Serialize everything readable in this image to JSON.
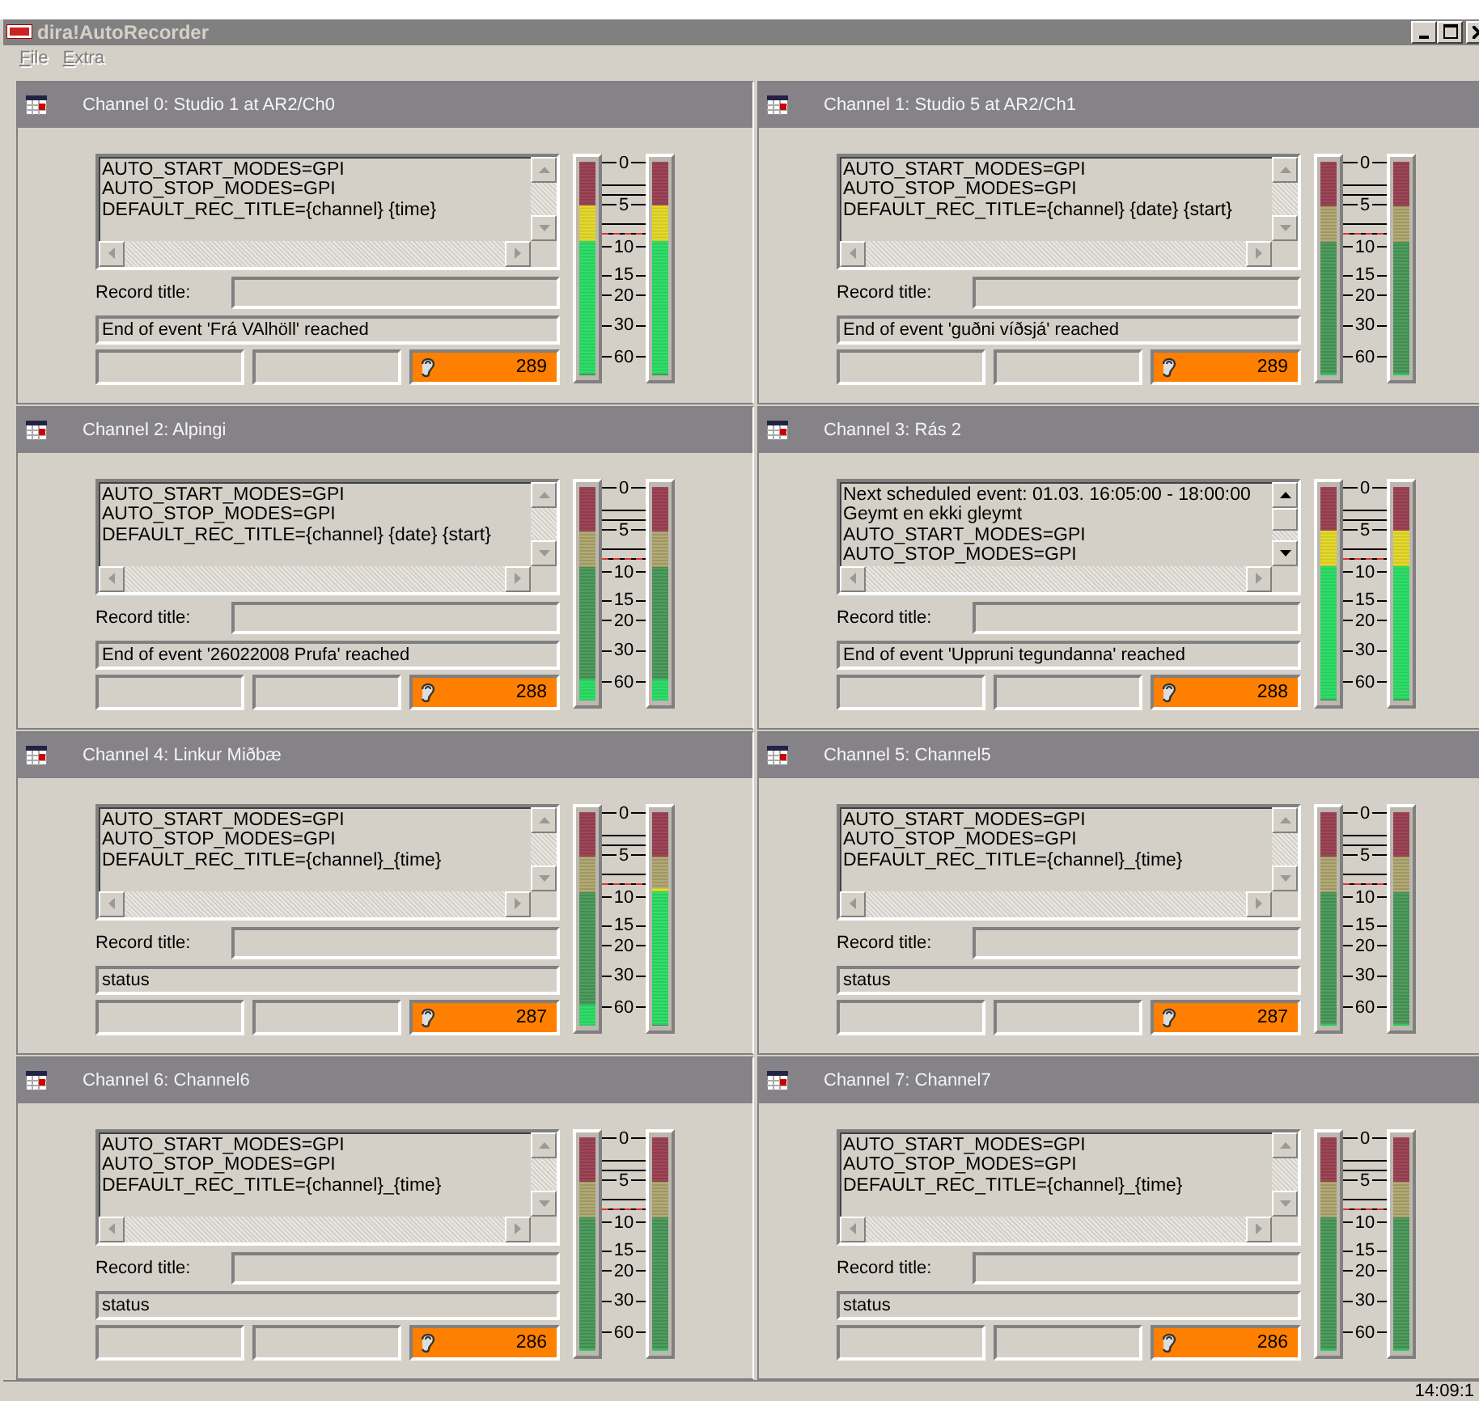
{
  "window": {
    "title": "dira!AutoRecorder"
  },
  "menu": [
    {
      "label": "File",
      "disabled": true
    },
    {
      "label": "Extra",
      "disabled": true
    }
  ],
  "channels": [
    {
      "title": "Channel 0: Studio 1 at AR2/Ch0",
      "lines": [
        "AUTO_START_MODES=GPI",
        "AUTO_STOP_MODES=GPI",
        "DEFAULT_REC_TITLE={channel} {time}"
      ],
      "scrollable": false,
      "record_title_label": "Record title:",
      "status": "End of event 'Frá VAlhöll' reached",
      "counter": "289",
      "meters": [
        {
          "level": 0.79
        },
        {
          "level": 0.79
        }
      ],
      "scale": [
        "0",
        "5",
        "10",
        "15",
        "20",
        "30",
        "60"
      ]
    },
    {
      "title": "Channel 1: Studio 5 at AR2/Ch1",
      "lines": [
        "AUTO_START_MODES=GPI",
        "AUTO_STOP_MODES=GPI",
        "DEFAULT_REC_TITLE={channel} {date} {start}"
      ],
      "scrollable": false,
      "record_title_label": "Record title:",
      "status": "End of event 'guðni víðsjá' reached",
      "counter": "289",
      "meters": [
        {
          "level": 0
        },
        {
          "level": 0
        }
      ],
      "scale": [
        "0",
        "5",
        "10",
        "15",
        "20",
        "30",
        "60"
      ]
    },
    {
      "title": "Channel 2: Alpingi",
      "lines": [
        "AUTO_START_MODES=GPI",
        "AUTO_STOP_MODES=GPI",
        "DEFAULT_REC_TITLE={channel} {date} {start}"
      ],
      "scrollable": false,
      "record_title_label": "Record title:",
      "status": "End of event '26022008 Prufa' reached",
      "counter": "288",
      "meters": [
        {
          "level": 0.1
        },
        {
          "level": 0.1
        }
      ],
      "scale": [
        "0",
        "5",
        "10",
        "15",
        "20",
        "30",
        "60"
      ]
    },
    {
      "title": "Channel 3: Rás 2",
      "lines": [
        "Next scheduled event: 01.03. 16:05:00 - 18:00:00",
        "Geymt en ekki gleymt",
        "AUTO_START_MODES=GPI",
        "AUTO_STOP_MODES=GPI"
      ],
      "scrollable": true,
      "record_title_label": "Record title:",
      "status": "End of event 'Uppruni tegundanna' reached",
      "counter": "288",
      "meters": [
        {
          "level": 0.79
        },
        {
          "level": 0.79
        }
      ],
      "scale": [
        "0",
        "5",
        "10",
        "15",
        "20",
        "30",
        "60"
      ]
    },
    {
      "title": "Channel 4: Linkur Miðbæ",
      "lines": [
        "AUTO_START_MODES=GPI",
        "AUTO_STOP_MODES=GPI",
        "DEFAULT_REC_TITLE={channel}_{time}"
      ],
      "scrollable": false,
      "record_title_label": "Record title:",
      "status": "status",
      "counter": "287",
      "meters": [
        {
          "level": 0.1
        },
        {
          "level": 0.64
        }
      ],
      "scale": [
        "0",
        "5",
        "10",
        "15",
        "20",
        "30",
        "60"
      ]
    },
    {
      "title": "Channel 5: Channel5",
      "lines": [
        "AUTO_START_MODES=GPI",
        "AUTO_STOP_MODES=GPI",
        "DEFAULT_REC_TITLE={channel}_{time}"
      ],
      "scrollable": false,
      "record_title_label": "Record title:",
      "status": "status",
      "counter": "287",
      "meters": [
        {
          "level": 0
        },
        {
          "level": 0
        }
      ],
      "scale": [
        "0",
        "5",
        "10",
        "15",
        "20",
        "30",
        "60"
      ]
    },
    {
      "title": "Channel 6: Channel6",
      "lines": [
        "AUTO_START_MODES=GPI",
        "AUTO_STOP_MODES=GPI",
        "DEFAULT_REC_TITLE={channel}_{time}"
      ],
      "scrollable": false,
      "record_title_label": "Record title:",
      "status": "status",
      "counter": "286",
      "meters": [
        {
          "level": 0
        },
        {
          "level": 0
        }
      ],
      "scale": [
        "0",
        "5",
        "10",
        "15",
        "20",
        "30",
        "60"
      ]
    },
    {
      "title": "Channel 7: Channel7",
      "lines": [
        "AUTO_START_MODES=GPI",
        "AUTO_STOP_MODES=GPI",
        "DEFAULT_REC_TITLE={channel}_{time}"
      ],
      "scrollable": false,
      "record_title_label": "Record title:",
      "status": "status",
      "counter": "286",
      "meters": [
        {
          "level": 0
        },
        {
          "level": 0
        }
      ],
      "scale": [
        "0",
        "5",
        "10",
        "15",
        "20",
        "30",
        "60"
      ]
    }
  ],
  "status_bar": {
    "time": "14:09:1"
  }
}
